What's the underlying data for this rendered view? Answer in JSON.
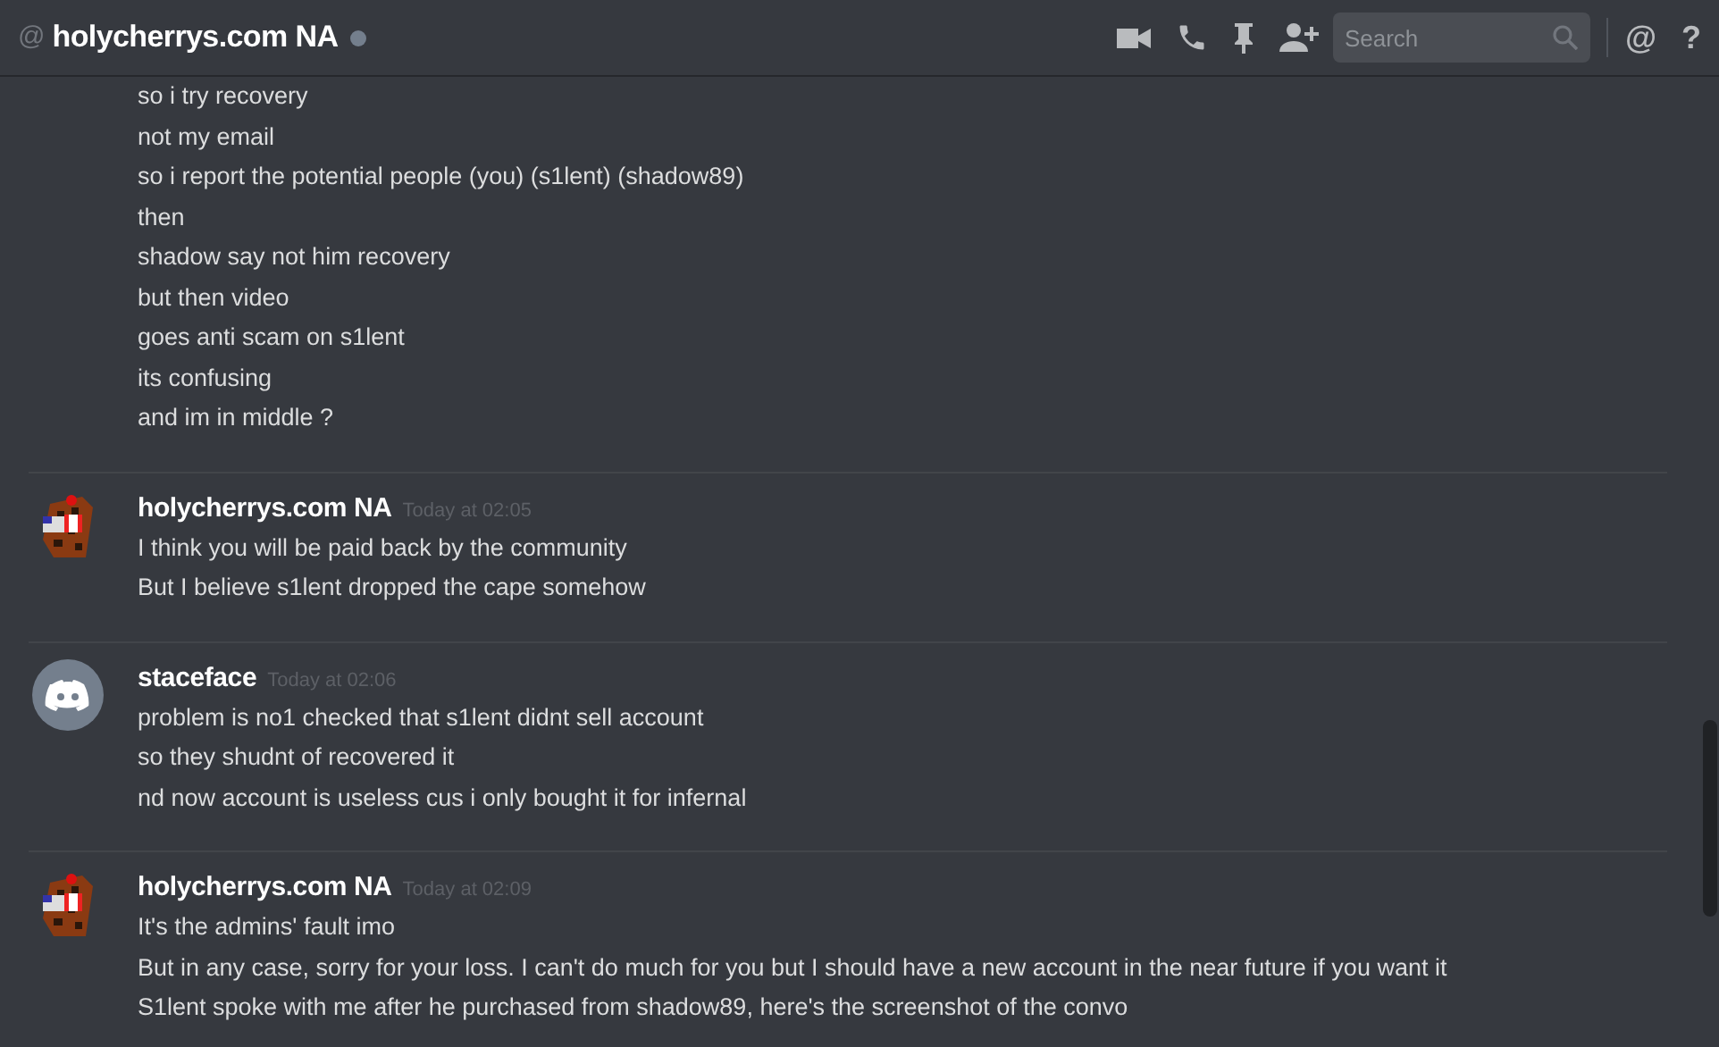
{
  "header": {
    "at": "@",
    "title": "holycherrys.com NA",
    "online": false,
    "search": {
      "placeholder": "Search"
    },
    "mention": "@",
    "help": "?"
  },
  "messages": [
    {
      "continued": true,
      "lines": [
        "so i try recovery",
        "not my email",
        "so i report the potential people (you) (s1lent) (shadow89)",
        "then",
        "shadow say not him recovery",
        "but then video",
        "goes anti scam on s1lent",
        "its confusing",
        "and im in middle ?"
      ]
    },
    {
      "continued": false,
      "kind": "custom_avatar",
      "author": "holycherrys.com NA",
      "time": "Today at 02:05",
      "lines": [
        "I think you will be paid back by the community",
        "But I believe s1lent dropped the cape somehow"
      ]
    },
    {
      "continued": false,
      "kind": "default_avatar",
      "author": "staceface",
      "time": "Today at 02:06",
      "lines": [
        "problem is no1 checked that s1lent didnt sell account",
        "so they shudnt of recovered it",
        "nd now account is useless cus i only bought it for infernal"
      ]
    },
    {
      "continued": false,
      "kind": "custom_avatar",
      "author": "holycherrys.com NA",
      "time": "Today at 02:09",
      "lines": [
        "It's the admins' fault imo",
        "But in any case, sorry for your loss. I can't do much for you but I should have a new account in the near future if you want it",
        "S1lent spoke with me after he purchased from shadow89, here's the screenshot of the convo"
      ]
    }
  ]
}
